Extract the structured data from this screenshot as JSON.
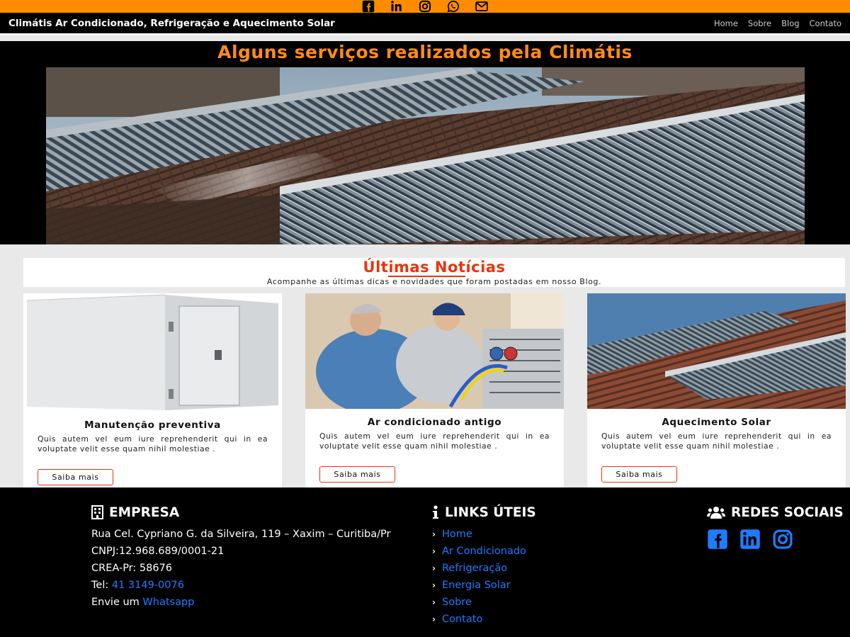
{
  "topbar": {
    "icons": [
      "facebook-icon",
      "linkedin-icon",
      "instagram-icon",
      "whatsapp-icon",
      "envelope-icon"
    ]
  },
  "nav": {
    "brand": "Climátis Ar Condicionado, Refrigeração e Aquecimento Solar",
    "links": [
      "Home",
      "Sobre",
      "Blog",
      "Contato"
    ]
  },
  "hero": {
    "title": "Alguns serviços realizados pela Climátis"
  },
  "news": {
    "title_a": "Últ",
    "title_b": "imas Not",
    "title_c": "ícias",
    "subtitle": "Acompanhe as últimas dicas e novidades que foram postadas em nosso Blog.",
    "cards": [
      {
        "title": "Manutenção preventiva",
        "text": "Quis autem vel eum iure reprehenderit qui in ea voluptate velit esse quam nihil molestiae .",
        "button": "Saiba mais"
      },
      {
        "title": "Ar condicionado antigo",
        "text": "Quis autem vel eum iure reprehenderit qui in ea voluptate velit esse quam nihil molestiae .",
        "button": "Saiba mais"
      },
      {
        "title": "Aquecimento Solar",
        "text": "Quis autem vel eum iure reprehenderit qui in ea voluptate velit esse quam nihil molestiae .",
        "button": "Saiba mais"
      }
    ]
  },
  "footer": {
    "empresa": {
      "heading": "EMPRESA",
      "address": "Rua Cel. Cypriano G. da Silveira, 119 – Xaxim – Curitiba/Pr",
      "cnpj": "CNPJ:12.968.689/0001-21",
      "crea": "CREA-Pr: 58676",
      "tel_label": "Tel: ",
      "tel": "41 3149-0076",
      "whats_label": "Envie um ",
      "whats": "Whatsapp"
    },
    "links": {
      "heading": "LINKS ÚTEIS",
      "items": [
        "Home",
        "Ar Condicionado",
        "Refrigeração",
        "Energia Solar",
        "Sobre",
        "Contato"
      ]
    },
    "social": {
      "heading": "REDES SOCIAIS",
      "icons": [
        "facebook-icon",
        "linkedin-icon",
        "instagram-icon"
      ]
    }
  },
  "colors": {
    "orange": "#ff8c00",
    "title_orange": "#ff8c1a",
    "red_accent": "#e8350f",
    "link_blue": "#1e7cff"
  }
}
